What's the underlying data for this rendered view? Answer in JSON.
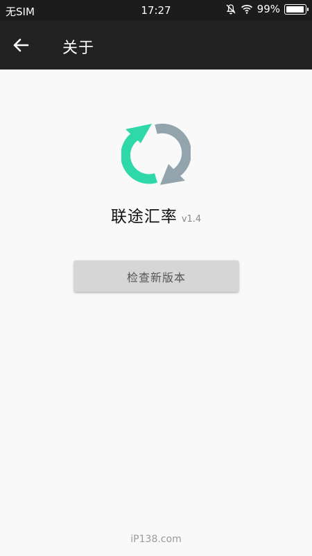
{
  "status_bar": {
    "carrier": "无SIM",
    "time": "17:27",
    "battery_percent": "99%",
    "battery_level": 0.99,
    "icons": [
      "bell-off-icon",
      "wifi-icon",
      "battery-icon"
    ]
  },
  "app_bar": {
    "title": "关于",
    "back_icon": "arrow-left-icon"
  },
  "about": {
    "app_name": "联途汇率",
    "version": "v1.4",
    "logo_icon": "refresh-arrows-icon",
    "check_update_label": "检查新版本"
  },
  "footer": {
    "watermark": "iP138.com"
  },
  "colors": {
    "status_bar_bg": "#1c1c1c",
    "app_bar_bg": "#222222",
    "logo_green": "#2ed8a8",
    "logo_gray": "#93a4ad",
    "button_bg": "#d6d6d6"
  }
}
